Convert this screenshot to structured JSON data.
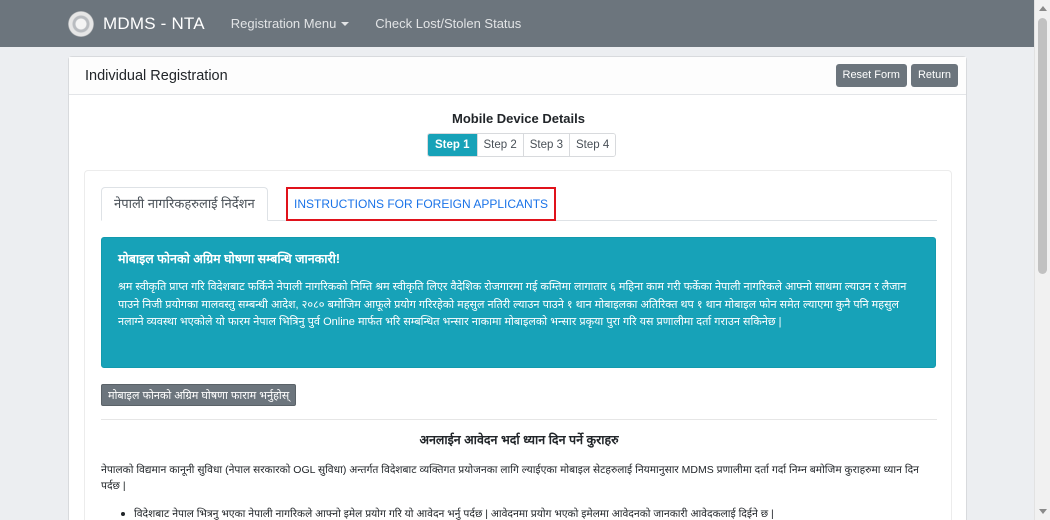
{
  "navbar": {
    "brand": "MDMS - NTA",
    "logo_icon": "nta-logo-icon",
    "links": [
      {
        "label": "Registration Menu",
        "has_caret": true
      },
      {
        "label": "Check Lost/Stolen Status",
        "has_caret": false
      }
    ]
  },
  "card": {
    "title": "Individual Registration",
    "reset_label": "Reset Form",
    "return_label": "Return",
    "section_title": "Mobile Device Details",
    "steps": [
      "Step 1",
      "Step 2",
      "Step 3",
      "Step 4"
    ],
    "active_step": "Step 1"
  },
  "tabs": {
    "nepali": "नेपाली नागरिकहरुलाई निर्देशन",
    "foreign": "INSTRUCTIONS FOR FOREIGN APPLICANTS"
  },
  "alert": {
    "heading": "मोबाइल फोनको अग्रिम घोषणा सम्बन्धि जानकारी!",
    "body": "श्रम स्वीकृति प्राप्त गरि विदेशबाट फर्किने नेपाली नागरिकको निम्ति श्रम स्वीकृति लिएर वैदेशिक रोजगारमा गई कम्तिमा लागातार ६ महिना काम गरी फर्केका नेपाली नागरिकले आफ्नो साथमा ल्याउन र लैजान पाउने निजी प्रयोगका मालवस्तु सम्बन्धी आदेश, २०८० बमोजिम आफूले प्रयोग गरिरहेको महसुल नतिरी ल्याउन पाउने १ थान मोबाइलका अतिरिक्त थप १ थान मोबाइल फोन समेत ल्याएमा कुनै पनि महसुल नलाग्ने व्यवस्था भएकोले यो फारम नेपाल भित्रिनु पुर्व Online मार्फत भरि सम्बन्धित भन्सार नाकामा मोबाइलको भन्सार प्रकृया पुरा गरि यस प्रणालीमा दर्ता गराउन सकिनेछ |"
  },
  "form_button": "मोबाइल फोनको अग्रिम घोषणा फाराम भर्नुहोस्",
  "notes": {
    "title": "अनलाईन आवेदन भर्दा ध्यान दिन पर्ने कुराहरु",
    "body": "नेपालको विद्यमान कानूनी सुविधा (नेपाल सरकारको OGL सुविधा) अन्तर्गत विदेशबाट व्यक्तिगत प्रयोजनका लागि ल्याईएका मोबाइल सेटहरुलाई नियमानुसार MDMS प्रणालीमा दर्ता गर्दा निम्न बमोजिम कुराहरुमा ध्यान दिन पर्दछ |",
    "bullets": [
      "विदेशबाट नेपाल भित्रनु भएका नेपाली नागरिकले आफ्नो इमेल प्रयोग गरि यो आवेदन भर्नु पर्दछ | आवेदनमा प्रयोग भएको इमेलमा आवेदनको जानकारी आवेदकलाई दिईने छ |"
    ]
  }
}
